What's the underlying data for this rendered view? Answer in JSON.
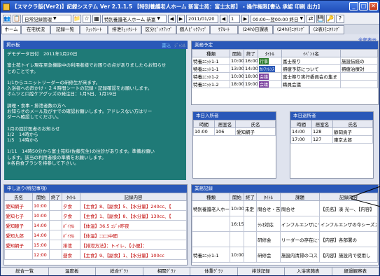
{
  "window": {
    "title": "【スマクラ版(Ver2)】記録システム Ver 2.1.1.5 【特別養護老人ホーム 新富士苑：富士太郎】 - 操作権限[書込 承認 印刷 出力]",
    "btn_min": "_",
    "btn_max": "□",
    "btn_close": "✕"
  },
  "toolbar": {
    "menu_label": "日常記録管理",
    "facility": "特別養護老人ホーム 新富",
    "date": "2011/01/20",
    "day": "1",
    "time": "00:00～翌00:00 終日",
    "prev": "◀",
    "next": "▶",
    "prev2": "◀",
    "next2": "▶"
  },
  "tabs": [
    {
      "label": "ホーム",
      "active": true
    },
    {
      "label": "在宅状況"
    },
    {
      "label": "記録一覧"
    },
    {
      "label": "ﾁｪｯｸｼｰﾄ"
    },
    {
      "label": "排泄ﾁｪｯｸｼｰﾄ"
    },
    {
      "label": "区分ﾋﾟｯｸｱｯﾌﾟ"
    },
    {
      "label": "個人ﾋﾟｯｸｱｯﾌﾟ"
    },
    {
      "label": "ｹｱﾙｰﾄ"
    },
    {
      "label": "(24h)日課表"
    },
    {
      "label": "(24h)ﾓﾆﾀﾘﾝｸﾞ"
    },
    {
      "label": "(2表)ﾓﾆﾀﾘﾝｸﾞ"
    }
  ],
  "link_all": "全部表示",
  "board": {
    "title": "掲示板",
    "write": "書込",
    "edit": "ｼﾞｬﾝﾙ",
    "text": "デモデータ日付　2011年1月20日\n\n富士苑トイレ現在至急機能中の利用者様でお困りの点がありましたらお知らせ\nとのことです。\n\n1/1からユニットリーダーの研修生が来ます。\n入浴者への声かけ・２４時間シートの記録・記録確認をお願いします。\nオムツと口腔ケアグッズの発注日：1月5日、1月19日\n\n調理・食事・排泄者数の方へ\nお知らせのメール及びすでの確認お願いします。アドレスない方はリー\nダーへ確認してください。\n\n1月の回診医者のお知らせ\n1/2　14時から\n1/5　14時から\n\n1/11　14時50分から富士苑科(佐藤先生)の往診があります。準備お願い\nします。該当の利用者様の準備をお願いします。\n※各自食ブラシを持参して下さい。"
  },
  "schedule": {
    "title": "業務予定",
    "headers": [
      "種類",
      "開始",
      "終了",
      "ﾀｲﾄﾙ",
      "ｲﾍﾞﾝﾄ名",
      ""
    ],
    "rows": [
      [
        "特養ﾕﾆｯﾄ1-1",
        "10:00",
        "16:00",
        "行事",
        "富士祭り",
        "施設伝統の"
      ],
      [
        "特養ﾕﾆｯﾄ1-1",
        "13:00",
        "14:00",
        "ｶﾝﾌｧﾚﾝｽ",
        "褥瘡予防について",
        "褥瘡治療対"
      ],
      [
        "特養ﾕﾆｯﾄ1-2",
        "10:00",
        "18:00",
        "会議",
        "富士祭り実行委員会の集ま",
        ""
      ],
      [
        "特養ﾕﾆｯﾄ1-2",
        "18:00",
        "19:00",
        "会議",
        "職員会議",
        ""
      ]
    ]
  },
  "admit": {
    "title": "本日入所者",
    "headers": [
      "時間",
      "居室名",
      "氏名"
    ],
    "rows": [
      [
        "10:00",
        "106",
        "愛知綱子"
      ]
    ]
  },
  "discharge": {
    "title": "本日退所者",
    "headers": [
      "時間",
      "居室名",
      "氏名"
    ],
    "rows": [
      [
        "14:00",
        "128",
        "静岡貢子"
      ],
      [
        "17:00",
        "127",
        "東京太郎"
      ]
    ]
  },
  "requests": {
    "title": "申し送り(特記事項)",
    "headers": [
      "氏名",
      "開始",
      "終了",
      "ﾀｲﾄﾙ",
      "記録内容"
    ],
    "rows": [
      [
        "愛知綱子",
        "10:00",
        "",
        "夕食",
        "【主食】8、【副食】5、【水分量】240cc、【"
      ],
      [
        "愛知七子",
        "10:00",
        "",
        "夕食",
        "【主食】1、【副食】8、【水分量】130cc、【"
      ],
      [
        "愛知瞳子",
        "14:00",
        "",
        "ﾊﾞｲﾀﾙ",
        "【体温】36.5 ｺｼﾞｬ昨夜"
      ],
      [
        "愛知九郎",
        "14:00",
        "",
        "ﾊﾞｲﾀﾙ",
        "【体温】ﾆｺﾆｺ中間"
      ],
      [
        "愛知綱子",
        "15:00",
        "",
        "排泄",
        "【排泄方法】：トイレ、【小便】："
      ],
      [
        "",
        "12:00",
        "",
        "昼食",
        "【主食】9、【副食】1、【水分量】100cc"
      ]
    ]
  },
  "work": {
    "title": "業務記録",
    "headers": [
      "種類",
      "開始",
      "終了",
      "ﾀｲﾄﾙ",
      "課題",
      "記録内容"
    ],
    "rows": [
      [
        "特別養護老人ホーム新富士苑",
        "10:00",
        "未定",
        "問合せ・苦情",
        "問合せ",
        "【氏名】湊 光一、【内容】"
      ],
      [
        "",
        "16:15",
        "",
        "ﾗｼｵ対応",
        "インフルエンザについて",
        "インフルエンザの今シーズン"
      ],
      [
        "",
        "",
        "",
        "研修会",
        "リーダーの存在について",
        "【内容】各部署の"
      ],
      [
        "特養ﾕﾆｯﾄ1-1",
        "10:00",
        "",
        "研修会",
        "施設内清掃のコスト削減",
        "【内容】施設内で使用し"
      ]
    ]
  },
  "bottom": [
    "総合一覧",
    "温度板",
    "総合ｸﾞﾗﾌ",
    "相関ｸﾞﾗﾌ",
    "体重ｸﾞﾗﾌ",
    "排泄記録",
    "入浴実施表",
    "経過観察表"
  ]
}
